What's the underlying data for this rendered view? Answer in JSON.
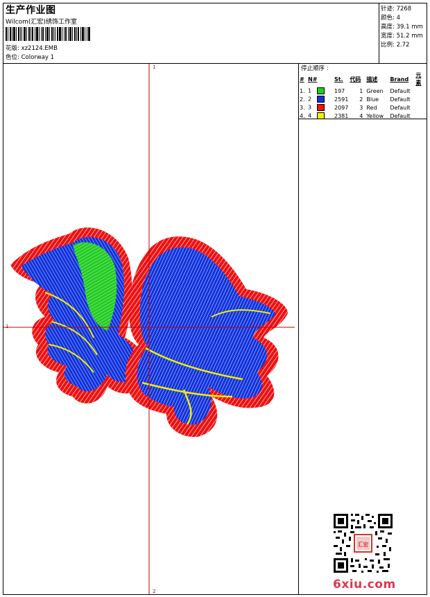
{
  "header": {
    "title": "生产作业图",
    "company": "Wilcom(汇宏)绣饰工作室",
    "design_label": "花版: xz2124.EMB",
    "colorway_label": "色位:  Colorway 1"
  },
  "stats": {
    "stitches": "针迹: 7268",
    "colors": "颜色: 4",
    "height": "高度: 39.1 mm",
    "width": "宽度: 51.2 mm",
    "ratio": "比例: 2.72"
  },
  "stop_sequence": {
    "heading": "停止顺序 :",
    "columns": [
      "#",
      "N#",
      "St.",
      "代码",
      "描述",
      "Brand",
      "元素"
    ],
    "rows": [
      {
        "num": "1.",
        "needle": "1",
        "color": "#22cc22",
        "stitches": "197",
        "code": "1",
        "desc": "Green",
        "brand": "Default"
      },
      {
        "num": "2.",
        "needle": "2",
        "color": "#1133dd",
        "stitches": "2591",
        "code": "2",
        "desc": "Blue",
        "brand": "Default"
      },
      {
        "num": "3.",
        "needle": "3",
        "color": "#ee1111",
        "stitches": "2097",
        "code": "3",
        "desc": "Red",
        "brand": "Default"
      },
      {
        "num": "4.",
        "needle": "4",
        "color": "#f2ee00",
        "stitches": "2381",
        "code": "4",
        "desc": "Yellow",
        "brand": "Default"
      }
    ]
  },
  "canvas": {
    "axis_top": "1",
    "axis_left": "1",
    "axis_bottom": "2"
  },
  "watermark": "6xiu.com",
  "qr_seal": "汇宏"
}
